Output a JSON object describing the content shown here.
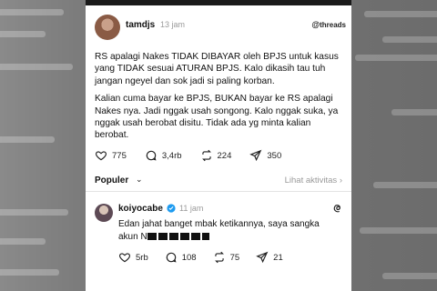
{
  "post": {
    "username": "tamdjs",
    "time": "13 jam",
    "brand": "threads",
    "paragraph1": "RS apalagi Nakes TIDAK DIBAYAR oleh BPJS untuk kasus yang TIDAK sesuai ATURAN BPJS. Kalo dikasih tau tuh jangan ngeyel dan sok jadi si paling korban.",
    "paragraph2": "Kalian cuma bayar ke BPJS, BUKAN bayar ke RS apalagi Nakes nya. Jadi nggak usah songong. Kalo nggak suka, ya nggak usah berobat disitu. Tidak ada yg minta kalian berobat.",
    "likes": "775",
    "comments": "3,4rb",
    "reposts": "224",
    "shares": "350"
  },
  "sort": {
    "label": "Populer",
    "activity_link": "Lihat aktivitas"
  },
  "reply": {
    "username": "koiyocabe",
    "time": "11 jam",
    "text_line1": "Edan jahat banget mbak ketikannya, saya sangka",
    "text_prefix": "akun N",
    "likes": "5rb",
    "comments": "108",
    "reposts": "75",
    "shares": "21"
  },
  "icons": {
    "like": "heart-icon",
    "comment": "comment-icon",
    "repost": "repost-icon",
    "share": "share-icon",
    "verified": "verified-badge-icon",
    "threads": "threads-icon"
  },
  "colors": {
    "text": "#111111",
    "muted": "#9a9a9a",
    "verified": "#1d9bf0"
  }
}
